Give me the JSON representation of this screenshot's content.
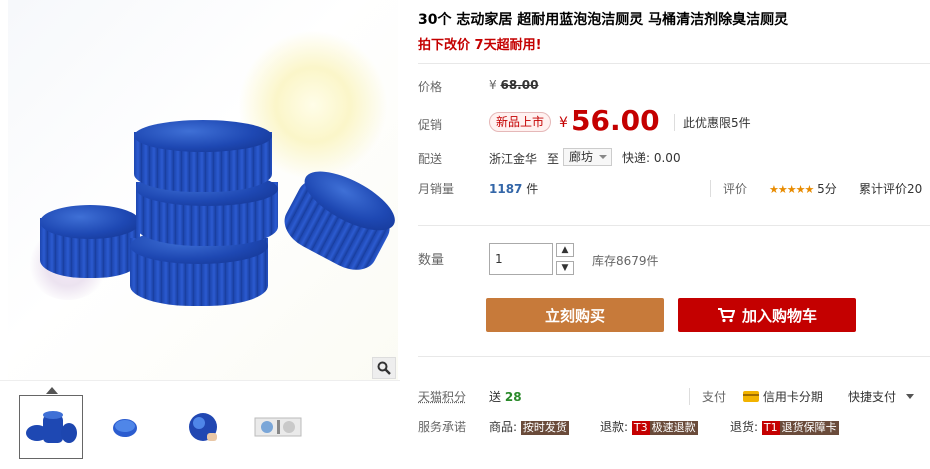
{
  "product": {
    "title": "30个 志动家居 超耐用蓝泡泡洁厕灵 马桶清洁剂除臭洁厕灵",
    "subtitle": "拍下改价 7天超耐用!"
  },
  "pricing": {
    "price_label": "价格",
    "currency": "¥",
    "original_price": "68.00",
    "promo_label": "促销",
    "promo_tag": "新品上市",
    "promo_price": "56.00",
    "limit_text": "此优惠限5件"
  },
  "shipping": {
    "label": "配送",
    "from": "浙江金华",
    "to_word": "至",
    "destination": "廊坊",
    "express": "快递: 0.00"
  },
  "sales": {
    "label": "月销量",
    "count": "1187",
    "unit": "件",
    "rating_label": "评价",
    "stars": "★★★★★",
    "score": "5分",
    "review_text": "累计评价20"
  },
  "quantity": {
    "label": "数量",
    "value": "1",
    "up": "▲",
    "down": "▼",
    "stock": "库存8679件"
  },
  "actions": {
    "buy_now": "立刻购买",
    "add_to_cart": "加入购物车"
  },
  "services": {
    "points_label": "天猫积分",
    "points_prefix": "送",
    "points_value": "28",
    "pay_label": "支付",
    "credit_card": "信用卡分期",
    "quick_pay": "快捷支付",
    "promise_label": "服务承诺",
    "goods_label": "商品:",
    "goods_badge": "按时发货",
    "refund_label": "退款:",
    "refund_code": "T3",
    "refund_badge": "极速退款",
    "return_label": "退货:",
    "return_code": "T1",
    "return_badge": "退货保障卡"
  },
  "colors": {
    "accent_red": "#c40000",
    "buy_orange": "#c77a3a",
    "tablet_blue": "#1e48b3"
  }
}
